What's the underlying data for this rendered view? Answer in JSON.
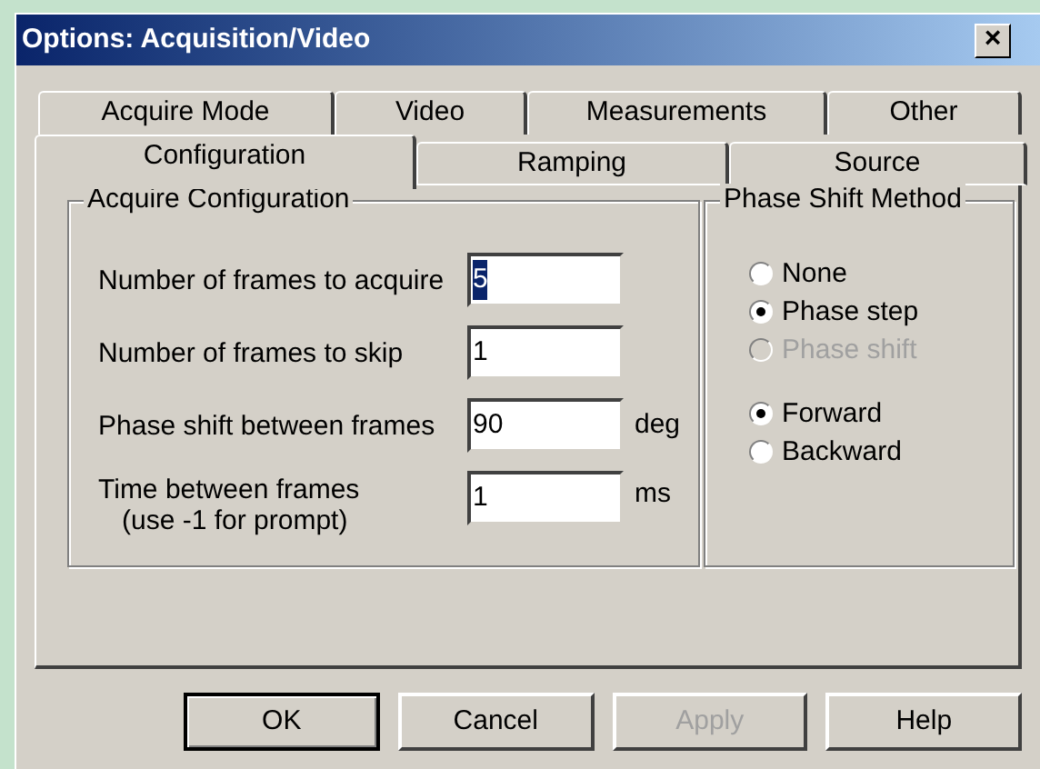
{
  "window": {
    "title": "Options: Acquisition/Video",
    "close": "×"
  },
  "tab_rows": [
    [
      {
        "label": "Acquire Mode",
        "selected": false
      },
      {
        "label": "Video",
        "selected": false
      },
      {
        "label": "Measurements",
        "selected": false
      },
      {
        "label": "Other",
        "selected": false
      }
    ],
    [
      {
        "label": "Configuration",
        "selected": true
      },
      {
        "label": "Ramping",
        "selected": false
      },
      {
        "label": "Source",
        "selected": false
      }
    ]
  ],
  "acquire_configuration": {
    "title": "Acquire Configuration",
    "fields": [
      {
        "label": "Number of frames to acquire",
        "value": "5",
        "text_selected": true
      },
      {
        "label": "Number of frames to skip",
        "value": "1",
        "text_selected": false
      },
      {
        "label": "Phase shift between frames",
        "value": "90",
        "unit": "deg",
        "text_selected": false
      },
      {
        "label": "Time between frames",
        "note": "(use -1 for prompt)",
        "value": "1",
        "unit": "ms",
        "text_selected": false
      }
    ]
  },
  "phase_shift_method": {
    "title": "Phase Shift Method",
    "groups": [
      [
        {
          "label": "None",
          "selected": false,
          "disabled": false
        },
        {
          "label": "Phase step",
          "selected": true,
          "disabled": false
        },
        {
          "label": "Phase shift",
          "selected": false,
          "disabled": true
        }
      ],
      [
        {
          "label": "Forward",
          "selected": true,
          "disabled": false
        },
        {
          "label": "Backward",
          "selected": false,
          "disabled": false
        }
      ]
    ]
  },
  "buttons": [
    {
      "label": "OK",
      "default": true,
      "disabled": false
    },
    {
      "label": "Cancel",
      "default": false,
      "disabled": false
    },
    {
      "label": "Apply",
      "default": false,
      "disabled": true
    },
    {
      "label": "Help",
      "default": false,
      "disabled": false
    }
  ]
}
